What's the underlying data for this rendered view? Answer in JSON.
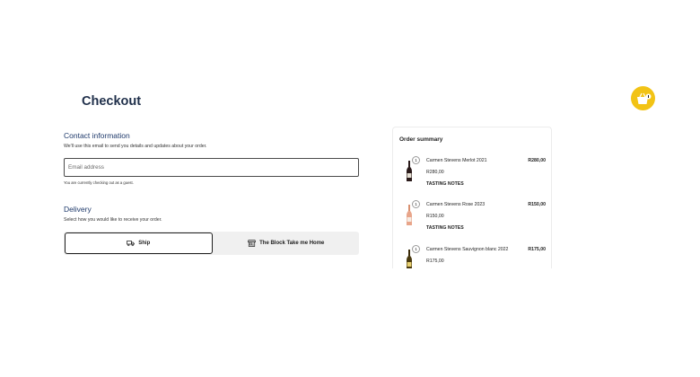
{
  "page": {
    "title": "Checkout"
  },
  "contact": {
    "heading": "Contact information",
    "description": "We'll use this email to send you details and updates about your order.",
    "email_placeholder": "Email address",
    "email_value": "",
    "guest_note": "You are currently checking out as a guest."
  },
  "delivery": {
    "heading": "Delivery",
    "description": "Select how you would like to receive your order.",
    "options": [
      {
        "label": "Ship",
        "icon": "truck-icon",
        "selected": true
      },
      {
        "label": "The Block Take me Home",
        "icon": "store-icon",
        "selected": false
      }
    ]
  },
  "order_summary": {
    "heading": "Order summary",
    "items": [
      {
        "quantity": "1",
        "name": "Carmen Stevens Merlot 2021",
        "unit_price": "R280,00",
        "total": "R280,00",
        "link": "TASTING NOTES",
        "bottle_color": "#2a1a1a"
      },
      {
        "quantity": "1",
        "name": "Carmen Stevens Rose 2023",
        "unit_price": "R150,00",
        "total": "R150,00",
        "link": "TASTING NOTES",
        "bottle_color": "#e8a58a"
      },
      {
        "quantity": "1",
        "name": "Carmen Stevens Sauvignon blanc 2022",
        "unit_price": "R175,00",
        "total": "R175,00",
        "link": "",
        "bottle_color": "#4a3a10"
      }
    ]
  },
  "cart_button": {
    "icon": "shopping-basket-icon",
    "color": "#f2c315"
  }
}
